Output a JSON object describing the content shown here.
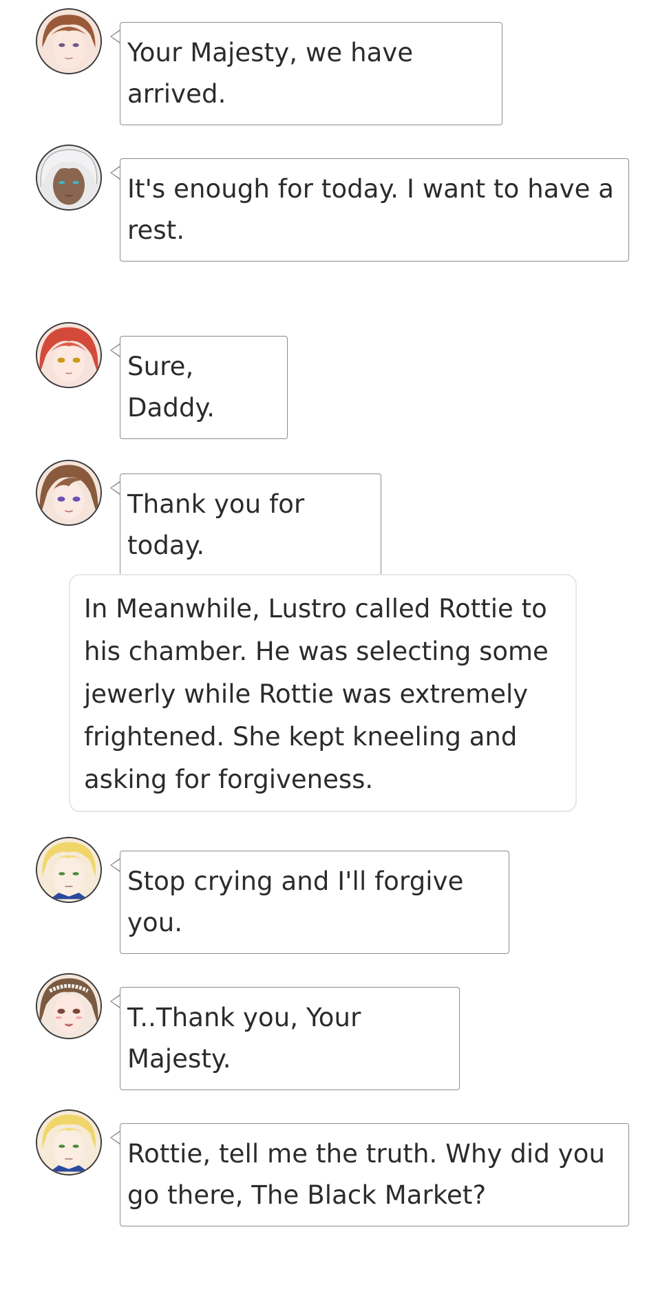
{
  "chat": {
    "messages": [
      {
        "speaker": "attendant",
        "avatar_icon": "brown-haired-man-avatar-icon",
        "text": "Your Majesty, we have arrived."
      },
      {
        "speaker": "king",
        "avatar_icon": "white-haired-man-avatar-icon",
        "text": "It's enough for today. I want to have a rest."
      },
      {
        "speaker": "daughter",
        "avatar_icon": "red-haired-girl-avatar-icon",
        "text": "Sure, Daddy."
      },
      {
        "speaker": "lady",
        "avatar_icon": "brown-haired-woman-avatar-icon",
        "text": "Thank you for today."
      },
      {
        "speaker": "lustro",
        "avatar_icon": "blonde-man-avatar-icon",
        "text": "Stop crying and I'll forgive you."
      },
      {
        "speaker": "rottie",
        "avatar_icon": "brown-haired-maid-avatar-icon",
        "text": "T..Thank you, Your Majesty."
      },
      {
        "speaker": "lustro",
        "avatar_icon": "blonde-man-avatar-icon",
        "text": "Rottie, tell me the truth. Why did you go there, The Black Market?"
      }
    ],
    "narration": "In Meanwhile, Lustro called Rottie to his chamber. He was selecting some jewerly while Rottie was extremely frightened. She kept kneeling and asking for forgiveness."
  },
  "colors": {
    "bubble_border": "#8c8c8c",
    "narration_border": "#e6e6e6",
    "text": "#2b2b2b"
  }
}
